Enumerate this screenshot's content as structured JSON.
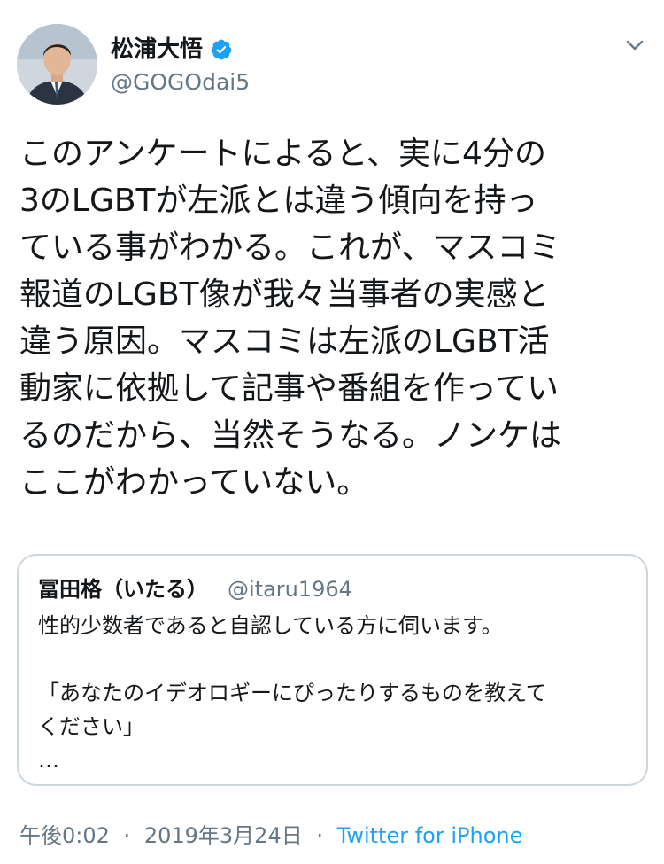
{
  "author": {
    "display_name": "松浦大悟",
    "handle": "@GOGOdai5",
    "verified": true
  },
  "tweet": {
    "lines": [
      "このアンケートによると、実に4分の",
      "3のLGBTが左派とは違う傾向を持っ",
      "ている事がわかる。これが、マスコミ",
      "報道のLGBT像が我々当事者の実感と",
      "違う原因。マスコミは左派のLGBT活",
      "動家に依拠して記事や番組を作ってい",
      "るのだから、当然そうなる。ノンケは",
      "ここがわかっていない。"
    ]
  },
  "quoted_tweet": {
    "display_name": "冨田格（いたる）",
    "handle": "@itaru1964",
    "lines": [
      "性的少数者であると自認している方に伺います。",
      "",
      "「あなたのイデオロギーにぴったりするものを教えて",
      "ください」",
      "…"
    ]
  },
  "footer": {
    "time": "午後0:02",
    "separator": "·",
    "date": "2019年3月24日",
    "source": "Twitter for iPhone"
  },
  "icons": {
    "verified": "verified-badge-icon",
    "menu": "chevron-down-icon"
  },
  "colors": {
    "text": "#14171a",
    "secondary": "#657786",
    "accent": "#1da1f2",
    "border": "#ccd6dd"
  }
}
